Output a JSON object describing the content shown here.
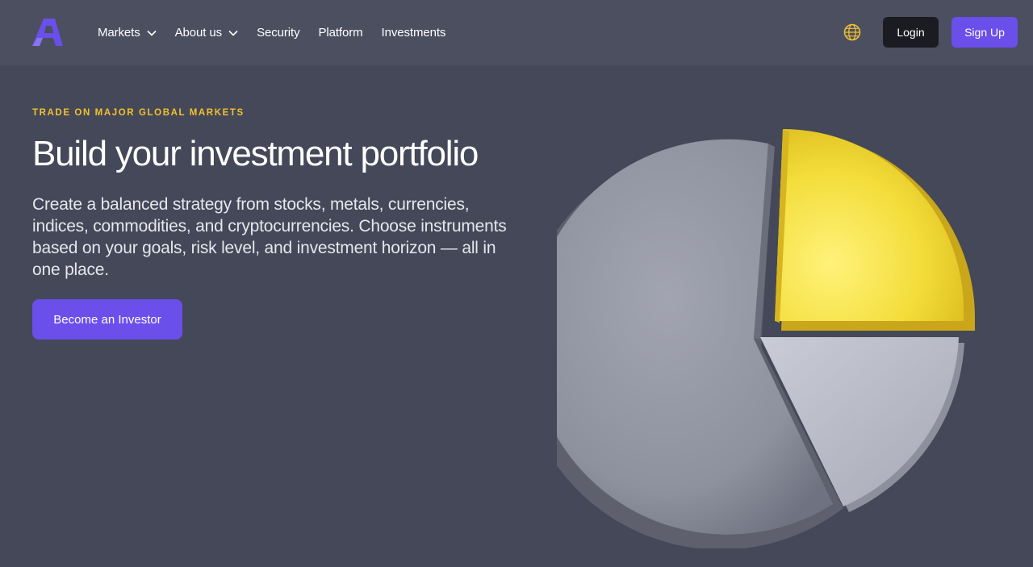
{
  "nav": {
    "menu": [
      {
        "label": "Markets",
        "has_dropdown": true
      },
      {
        "label": "About us",
        "has_dropdown": true
      },
      {
        "label": "Security",
        "has_dropdown": false
      },
      {
        "label": "Platform",
        "has_dropdown": false
      },
      {
        "label": "Investments",
        "has_dropdown": false
      }
    ],
    "language_icon": "globe-icon",
    "login_label": "Login",
    "signup_label": "Sign Up"
  },
  "hero": {
    "eyebrow": "TRADE ON MAJOR GLOBAL MARKETS",
    "title": "Build your investment portfolio",
    "description": "Create a balanced strategy from stocks, metals, currencies, indices, commodities, and cryptocurrencies. Choose instruments based on your goals, risk level, and investment horizon — all in one place.",
    "cta_label": "Become an Investor"
  },
  "colors": {
    "brand": "#6a4fea",
    "accent_yellow": "#f2c12e",
    "background": "#444858",
    "nav_background": "#4b4f60",
    "login_background": "#1b1c22"
  }
}
